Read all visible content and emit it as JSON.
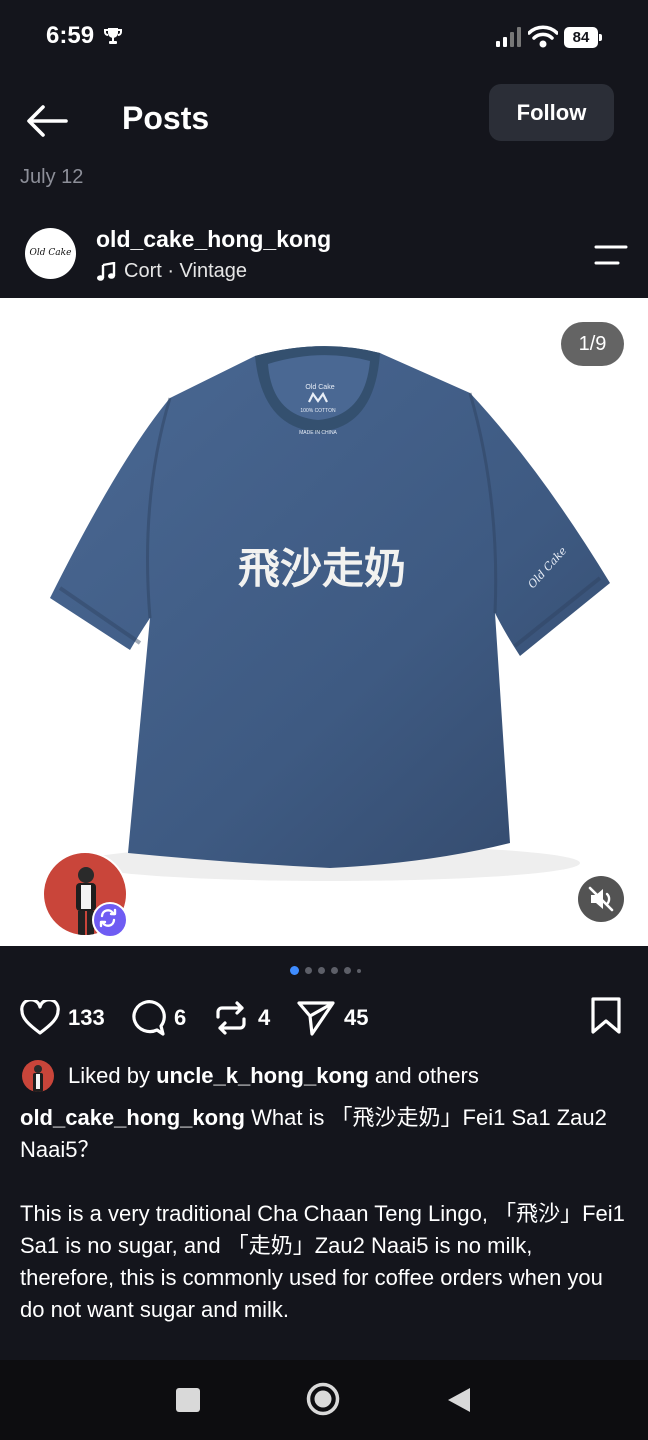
{
  "status": {
    "time": "6:59",
    "battery": "84",
    "icons": [
      "trophy-icon",
      "signal-icon",
      "wifi-icon",
      "battery-icon"
    ]
  },
  "header": {
    "title": "Posts",
    "follow_label": "Follow"
  },
  "post": {
    "date": "July 12",
    "avatar_text": "Old Cake",
    "username": "old_cake_hong_kong",
    "music": "Cort · Vintage",
    "image": {
      "counter": "1/9",
      "shirt_print": "飛沙走奶",
      "sleeve_text": "Old Cake",
      "tag_brand": "Old Cake",
      "tag_lines": [
        "100% COTTON",
        "MADE IN CHINA"
      ]
    },
    "carousel": {
      "count": 6,
      "active_index": 0
    },
    "actions": {
      "likes": "133",
      "comments": "6",
      "reposts": "4",
      "shares": "45"
    },
    "liked_by": {
      "prefix": "Liked by",
      "user": "uncle_k_hong_kong",
      "suffix": "and others"
    },
    "caption": {
      "username": "old_cake_hong_kong",
      "text": "What is 「飛沙走奶」Fei1 Sa1 Zau2 Naai5？"
    },
    "body": "This is a very traditional Cha Chaan Teng Lingo, 「飛沙」Fei1 Sa1 is no sugar, and 「走奶」Zau2 Naai5 is no milk, therefore, this is commonly used for coffee orders when you do not want sugar and milk."
  },
  "colors": {
    "background": "#14151c",
    "accent": "#3f8cff",
    "badge": "#6f5cf3",
    "shirt": "#3e5a82"
  }
}
